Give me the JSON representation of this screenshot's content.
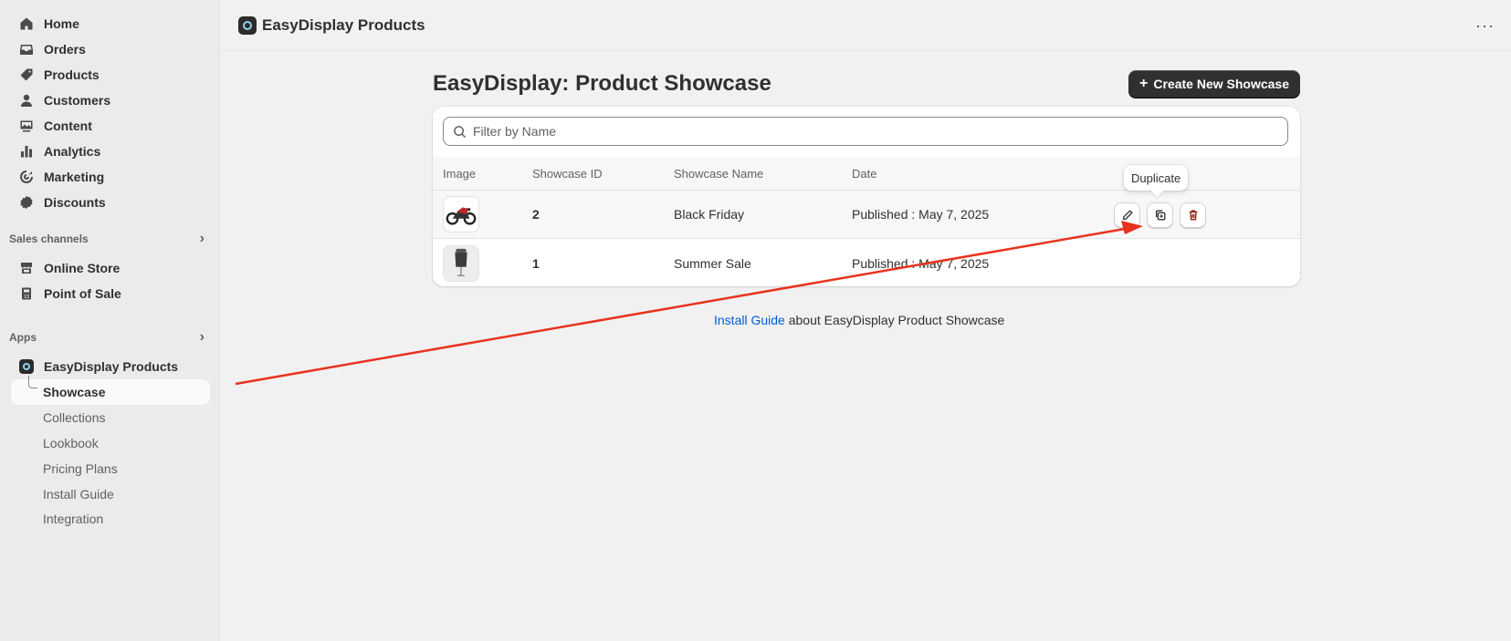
{
  "sidebar": {
    "items": [
      {
        "label": "Home",
        "icon": "home-icon"
      },
      {
        "label": "Orders",
        "icon": "inbox-icon"
      },
      {
        "label": "Products",
        "icon": "tag-icon"
      },
      {
        "label": "Customers",
        "icon": "person-icon"
      },
      {
        "label": "Content",
        "icon": "image-icon"
      },
      {
        "label": "Analytics",
        "icon": "bar-chart-icon"
      },
      {
        "label": "Marketing",
        "icon": "target-icon"
      },
      {
        "label": "Discounts",
        "icon": "discount-icon"
      }
    ],
    "sales_channels_label": "Sales channels",
    "sales_channels": [
      {
        "label": "Online Store",
        "icon": "store-icon"
      },
      {
        "label": "Point of Sale",
        "icon": "pos-icon"
      }
    ],
    "apps_label": "Apps",
    "app_name": "EasyDisplay Products",
    "app_subitems": [
      "Showcase",
      "Collections",
      "Lookbook",
      "Pricing Plans",
      "Install Guide",
      "Integration"
    ]
  },
  "topbar": {
    "title": "EasyDisplay Products",
    "more": "···"
  },
  "page": {
    "title": "EasyDisplay: Product Showcase",
    "create_button": "Create New Showcase",
    "filter_placeholder": "Filter by Name"
  },
  "table": {
    "headers": [
      "Image",
      "Showcase ID",
      "Showcase Name",
      "Date"
    ],
    "rows": [
      {
        "id": "2",
        "name": "Black Friday",
        "date": "Published : May 7, 2025",
        "image": "motorcycle"
      },
      {
        "id": "1",
        "name": "Summer Sale",
        "date": "Published : May 7, 2025",
        "image": "mannequin"
      }
    ]
  },
  "tooltip": "Duplicate",
  "footer": {
    "link": "Install Guide",
    "text": " about EasyDisplay Product Showcase"
  },
  "colors": {
    "accent_link": "#005bd3",
    "primary_button": "#303030",
    "annotation_arrow": "#e8321e"
  }
}
